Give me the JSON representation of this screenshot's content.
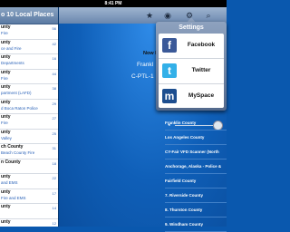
{
  "status_bar": {
    "time": "8:41 PM"
  },
  "left_panel": {
    "title": "o 10 Local Places",
    "rows": [
      {
        "title": "unty",
        "subtitle": "Fire",
        "count": "56"
      },
      {
        "title": "unty",
        "subtitle": "ce and Fire",
        "count": "42"
      },
      {
        "title": "unty",
        "subtitle": "Departments",
        "count": "16"
      },
      {
        "title": "unty",
        "subtitle": "Fire",
        "count": "44"
      },
      {
        "title": "unty",
        "subtitle": "partment (LAFD)",
        "count": "38"
      },
      {
        "title": "unty",
        "subtitle": "d Boca Raton Police",
        "count": "29"
      },
      {
        "title": "unty",
        "subtitle": "Fire",
        "count": "27"
      },
      {
        "title": "unty",
        "subtitle": "Valley",
        "count": "25"
      },
      {
        "title": "ch County",
        "subtitle": "Beach County Fire",
        "count": "31"
      },
      {
        "title": "n County",
        "subtitle": "",
        "count": "18"
      },
      {
        "title": "unty",
        "subtitle": "and EMS",
        "count": "22"
      },
      {
        "title": "unty",
        "subtitle": "Fire and EMS",
        "count": "17"
      },
      {
        "title": "unty",
        "subtitle": "",
        "count": "14"
      },
      {
        "title": "unty",
        "subtitle": "",
        "count": "12"
      }
    ]
  },
  "toolbar": {
    "icons": [
      "star-icon",
      "radio-icon",
      "gear-icon",
      "search-icon"
    ]
  },
  "detail": {
    "now_playing": "Now Pla",
    "feed_name": "Frankl",
    "feed_code": "C-PTL-1"
  },
  "favorites": [
    "Franklin County",
    "Los Angeles County",
    "CY-Fair VFD Scanner (North",
    "Anchorage, Alaska - Police &",
    "Fairfield County",
    "7. Riverside County",
    "8. Thurston County",
    "9. Windham County"
  ],
  "settings_popover": {
    "title": "Settings",
    "options": [
      {
        "label": "Facebook",
        "icon": "facebook-icon",
        "color": "#3b5998",
        "glyph": "f"
      },
      {
        "label": "Twitter",
        "icon": "twitter-icon",
        "color": "#33b0e8",
        "glyph": "t"
      },
      {
        "label": "MySpace",
        "icon": "myspace-icon",
        "color": "#1d4e8f",
        "glyph": "m"
      }
    ]
  }
}
